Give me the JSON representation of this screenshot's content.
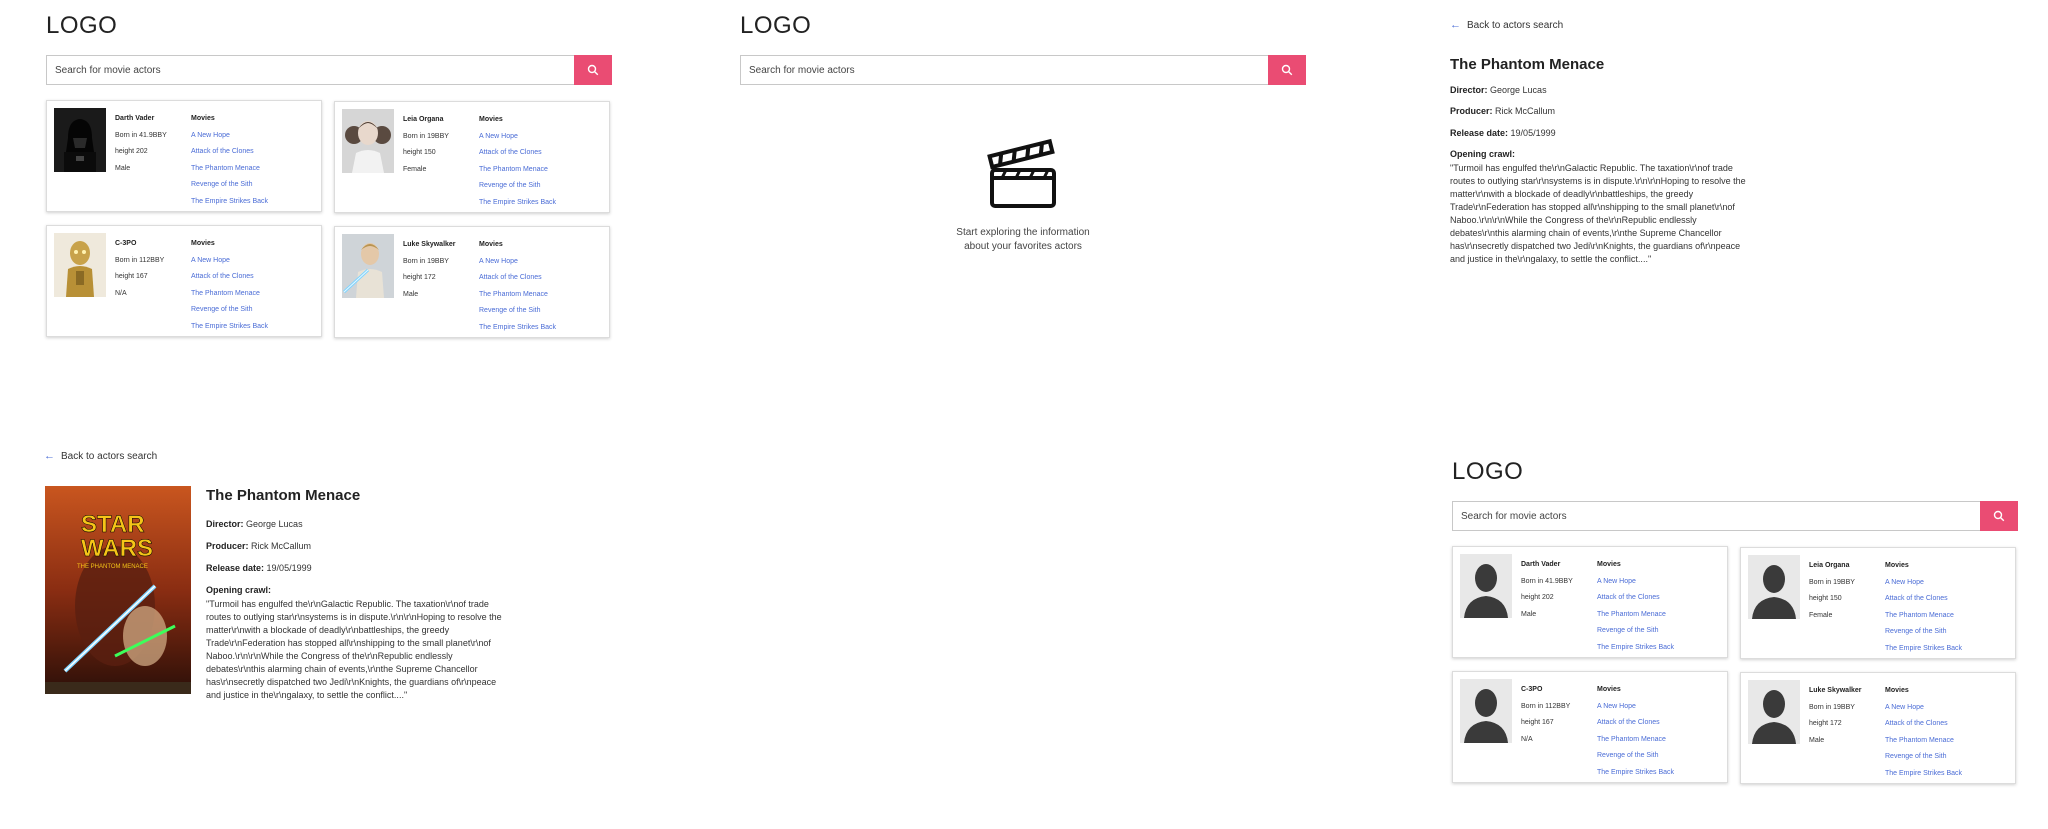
{
  "search": {
    "logo": "LOGO",
    "placeholder": "Search for movie actors"
  },
  "actors": [
    {
      "name": "Darth Vader",
      "born": "Born in 41.9BBY",
      "height": "height 202",
      "gender": "Male"
    },
    {
      "name": "Leia Organa",
      "born": "Born in 19BBY",
      "height": "height 150",
      "gender": "Female"
    },
    {
      "name": "C-3PO",
      "born": "Born in 112BBY",
      "height": "height 167",
      "gender": "N/A"
    },
    {
      "name": "Luke Skywalker",
      "born": "Born in 19BBY",
      "height": "height 172",
      "gender": "Male"
    }
  ],
  "movies_title": "Movies",
  "movies": [
    "A New Hope",
    "Attack of the Clones",
    "The Phantom Menace",
    "Revenge of the Sith",
    "The Empire Strikes Back"
  ],
  "empty_state": {
    "line1": "Start exploring the information",
    "line2": "about your favorites actors"
  },
  "film": {
    "back_label": "Back to actors search",
    "title": "The Phantom Menace",
    "director_label": "Director:",
    "director": "George Lucas",
    "producer_label": "Producer:",
    "producer": "Rick McCallum",
    "release_label": "Release date:",
    "release": "19/05/1999",
    "crawl_label": "Opening crawl:",
    "crawl_lines": [
      "\"Turmoil has engulfed the\\r\\nGalactic Republic. The taxation\\r\\nof trade",
      "routes to outlying star\\r\\nsystems is in dispute.\\r\\n\\r\\nHoping to resolve the",
      "matter\\r\\nwith a blockade of deadly\\r\\nbattleships, the greedy",
      "Trade\\r\\nFederation has stopped all\\r\\nshipping to the small planet\\r\\nof",
      "Naboo.\\r\\n\\r\\nWhile the Congress of the\\r\\nRepublic endlessly",
      "debates\\r\\nthis alarming chain of events,\\r\\nthe Supreme Chancellor",
      "has\\r\\nsecretly dispatched two Jedi\\r\\nKnights, the guardians of\\r\\npeace",
      "and justice in the\\r\\ngalaxy, to settle the conflict....\""
    ],
    "poster": {
      "line1": "STAR",
      "line2": "WARS",
      "line3": "THE PHANTOM MENACE"
    }
  }
}
